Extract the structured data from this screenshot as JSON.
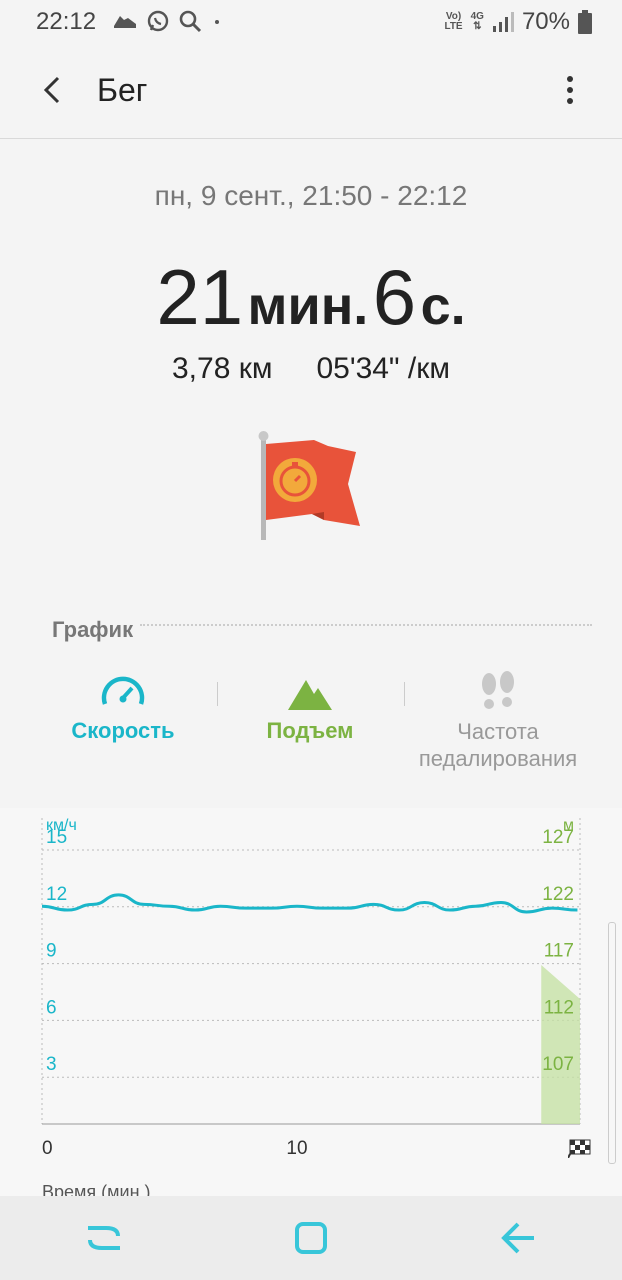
{
  "status_bar": {
    "time": "22:12",
    "network_top": "Vo)",
    "network_bottom": "LTE",
    "net_4g": "4G",
    "battery": "70%"
  },
  "app_bar": {
    "title": "Бег"
  },
  "summary": {
    "date_range": "пн, 9 сент., 21:50 - 22:12",
    "duration_min": "21",
    "duration_min_unit": "мин.",
    "duration_sec": "6",
    "duration_sec_unit": "с.",
    "distance": "3,78 км",
    "pace": "05'34\" /км"
  },
  "graph": {
    "section_title": "График",
    "tabs": [
      {
        "label": "Скорость",
        "icon": "speedometer-icon",
        "color": "#1ab6c9"
      },
      {
        "label": "Подъем",
        "icon": "mountain-icon",
        "color": "#7cb342"
      },
      {
        "label": "Частота педалирования",
        "icon": "footprints-icon",
        "color": "#aaaaaa"
      }
    ]
  },
  "chart_data": {
    "type": "line",
    "left_axis_unit": "км/ч",
    "right_axis_unit": "м",
    "left_ticks": [
      "15",
      "12",
      "9",
      "6",
      "3"
    ],
    "right_ticks": [
      "127",
      "122",
      "117",
      "112",
      "107"
    ],
    "x_ticks": [
      "0",
      "10"
    ],
    "xlabel": "Время (мин.)",
    "ylim_speed": [
      0,
      15
    ],
    "ylim_elevation": [
      102,
      127
    ],
    "series": [
      {
        "color": "#1ab6c9",
        "x": [
          0,
          1,
          2,
          3,
          4,
          5,
          6,
          7,
          8,
          9,
          10,
          11,
          12,
          13,
          14,
          15,
          16,
          17,
          18,
          19,
          20,
          21
        ],
        "values": [
          11.5,
          11.3,
          11.6,
          12.1,
          11.6,
          11.5,
          11.3,
          11.5,
          11.4,
          11.4,
          11.5,
          11.4,
          11.4,
          11.6,
          11.3,
          11.7,
          11.3,
          11.5,
          11.7,
          11.2,
          11.4,
          11.3
        ]
      },
      {
        "color": "#c5e1a5",
        "x": [
          20.6,
          21.1
        ],
        "values": [
          116,
          113
        ]
      }
    ],
    "colors": {
      "speed": "#1ab6c9",
      "elevation": "#7cb342"
    }
  }
}
